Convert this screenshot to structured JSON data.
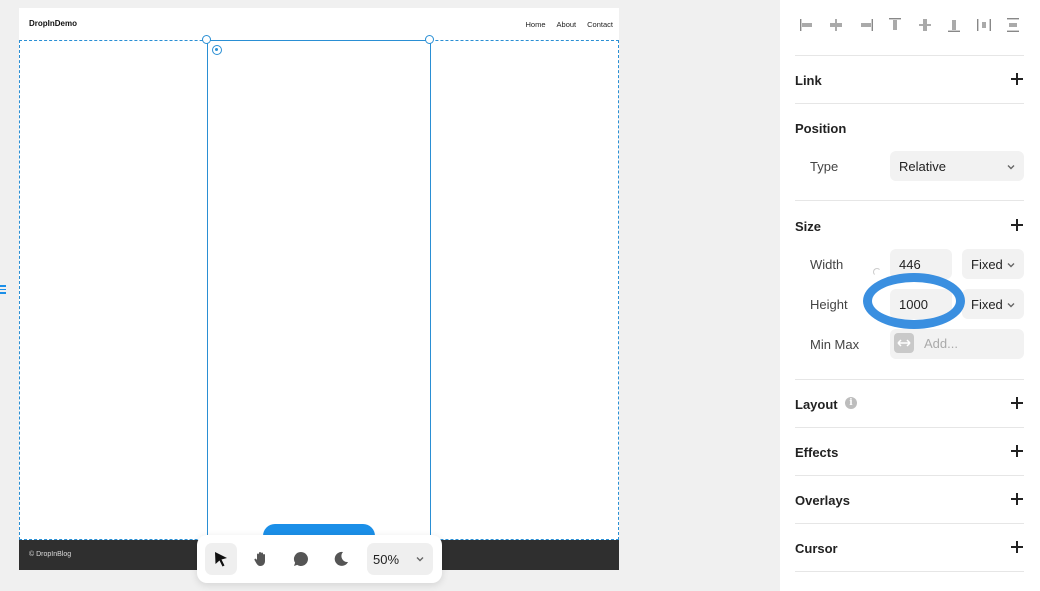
{
  "canvas": {
    "site": {
      "logo": "DropInDemo",
      "nav": [
        "Home",
        "About",
        "Contact"
      ],
      "footer": "© DropInBlog"
    },
    "toolbar": {
      "zoom": "50%",
      "tools": [
        "cursor-icon",
        "hand-icon",
        "comment-icon",
        "moon-icon"
      ]
    }
  },
  "panel": {
    "sections": {
      "link": "Link",
      "position": "Position",
      "size": "Size",
      "layout": "Layout",
      "effects": "Effects",
      "overlays": "Overlays",
      "cursor": "Cursor"
    },
    "position": {
      "type_label": "Type",
      "type_value": "Relative"
    },
    "size": {
      "width_label": "Width",
      "width_value": "446",
      "width_mode": "Fixed",
      "height_label": "Height",
      "height_value": "1000",
      "height_mode": "Fixed",
      "minmax_label": "Min Max",
      "minmax_placeholder": "Add..."
    },
    "layout_info": "i"
  },
  "colors": {
    "selection": "#2a8fd4",
    "accent": "#1b8fe8",
    "highlight_ring": "#3a8fe0",
    "footer_bg": "#2f2f2f"
  }
}
